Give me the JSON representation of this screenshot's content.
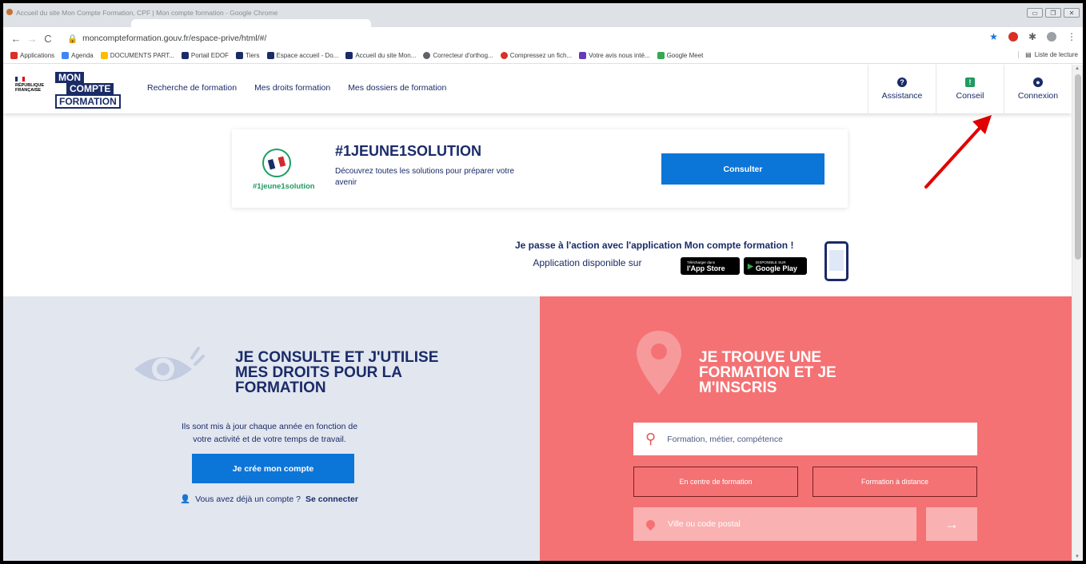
{
  "browser": {
    "window_title": "Accueil du site Mon Compte Formation, CPF | Mon compte formation - Google Chrome",
    "url": "moncompteformation.gouv.fr/espace-prive/html/#/",
    "bookmarks": [
      {
        "label": "Applications",
        "color": "#d93025"
      },
      {
        "label": "Agenda",
        "color": "#4285f4"
      },
      {
        "label": "DOCUMENTS PART...",
        "color": "#fbbc04"
      },
      {
        "label": "Portail EDOF",
        "color": "#1a2b68"
      },
      {
        "label": "Tiers",
        "color": "#1a2b68"
      },
      {
        "label": "Espace accueil - Do...",
        "color": "#1a2b68"
      },
      {
        "label": "Accueil du site Mon...",
        "color": "#1a2b68"
      },
      {
        "label": "Correcteur d'orthog...",
        "color": "#5f6368"
      },
      {
        "label": "Compressez un fich...",
        "color": "#d93025"
      },
      {
        "label": "Votre avis nous inté...",
        "color": "#673ab7"
      },
      {
        "label": "Google Meet",
        "color": "#34a853"
      }
    ],
    "reading_list": "Liste de lecture"
  },
  "header": {
    "rf": [
      "RÉPUBLIQUE",
      "FRANÇAISE"
    ],
    "logo": {
      "mon": "MON",
      "compte": "COMPTE",
      "formation": "FORMATION"
    },
    "nav": [
      "Recherche de formation",
      "Mes droits formation",
      "Mes dossiers de formation"
    ],
    "actions": {
      "assistance": "Assistance",
      "conseil": "Conseil",
      "connexion": "Connexion"
    }
  },
  "banner": {
    "tag": "#1jeune1solution",
    "title": "#1JEUNE1SOLUTION",
    "subtitle": "Découvrez toutes les solutions pour préparer votre avenir",
    "button": "Consulter"
  },
  "app": {
    "line1": "Je passe à l'action avec l'application Mon compte formation !",
    "line2": "Application disponible sur",
    "appstore_small": "Télécharger dans",
    "appstore": "l'App Store",
    "play_small": "DISPONIBLE SUR",
    "play": "Google Play"
  },
  "left": {
    "heading": "JE CONSULTE ET J'UTILISE MES DROITS POUR LA FORMATION",
    "text": "Ils sont mis à jour chaque année en fonction de votre activité et de votre temps de travail.",
    "button": "Je crée mon compte",
    "already": "Vous avez déjà un compte ?",
    "login": "Se connecter"
  },
  "right": {
    "heading": "JE TROUVE UNE FORMATION ET JE M'INSCRIS",
    "search_placeholder": "Formation, métier, compétence",
    "opt1": "En centre de formation",
    "opt2": "Formation à distance",
    "city_placeholder": "Ville ou code postal"
  },
  "colors": {
    "primary": "#1a2b68",
    "accent": "#0c75d8",
    "salmon": "#f47274",
    "annotation": "#e00000"
  }
}
